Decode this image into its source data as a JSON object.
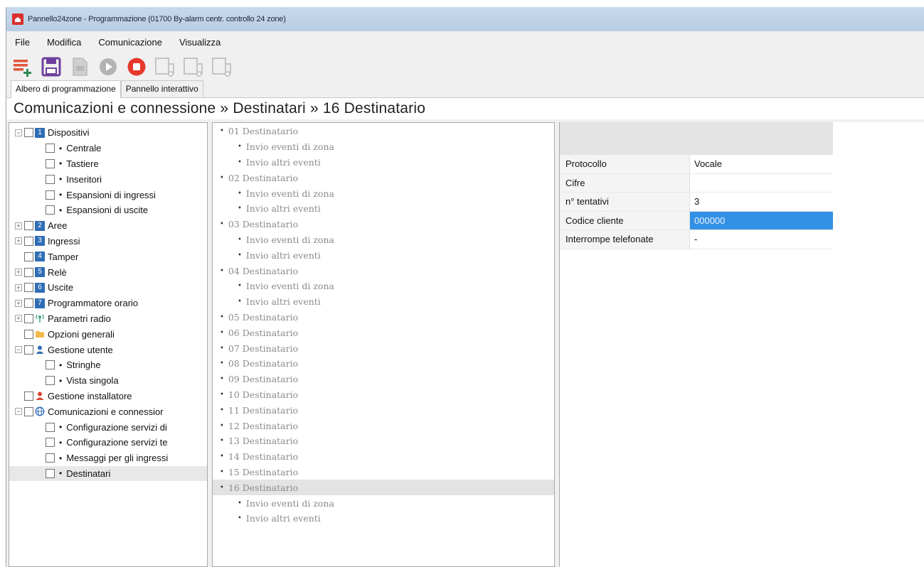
{
  "window": {
    "title": "Pannello24zone - Programmazione (01700  By-alarm centr. controllo 24 zone)"
  },
  "menu": [
    "File",
    "Modifica",
    "Comunicazione",
    "Visualizza"
  ],
  "toolbar": {
    "icons": [
      "add-list-icon",
      "save-icon",
      "document-icon",
      "play-icon",
      "stop-icon",
      "window-connect-icon",
      "window-connect-icon",
      "window-connect-icon"
    ],
    "colors": {
      "accent": "#e2543c",
      "save": "#6e3f9e",
      "stop": "#e7382c",
      "disabled": "#b9b9b9"
    }
  },
  "tabs": [
    "Albero di programmazione",
    "Pannello interattivo"
  ],
  "breadcrumb": "Comunicazioni e connessione » Destinatari » 16 Destinatario",
  "tree": [
    {
      "label": "Dispositivi",
      "level": 0,
      "expander": "-",
      "icon": "1"
    },
    {
      "label": "Centrale",
      "level": 1
    },
    {
      "label": "Tastiere",
      "level": 1
    },
    {
      "label": "Inseritori",
      "level": 1
    },
    {
      "label": "Espansioni di ingressi",
      "level": 1
    },
    {
      "label": "Espansioni di uscite",
      "level": 1
    },
    {
      "label": "Aree",
      "level": 0,
      "expander": "+",
      "icon": "2"
    },
    {
      "label": "Ingressi",
      "level": 0,
      "expander": "+",
      "icon": "3"
    },
    {
      "label": "Tamper",
      "level": 0,
      "expander": "",
      "icon": "4"
    },
    {
      "label": "Relè",
      "level": 0,
      "expander": "+",
      "icon": "5"
    },
    {
      "label": "Uscite",
      "level": 0,
      "expander": "+",
      "icon": "6"
    },
    {
      "label": "Programmatore orario",
      "level": 0,
      "expander": "+",
      "icon": "7"
    },
    {
      "label": "Parametri radio",
      "level": 0,
      "expander": "+",
      "icon": "radio"
    },
    {
      "label": "Opzioni generali",
      "level": 0,
      "expander": "",
      "icon": "folder"
    },
    {
      "label": "Gestione utente",
      "level": 0,
      "expander": "-",
      "icon": "user"
    },
    {
      "label": "Stringhe",
      "level": 1
    },
    {
      "label": "Vista singola",
      "level": 1
    },
    {
      "label": "Gestione installatore",
      "level": 0,
      "expander": "",
      "icon": "installer"
    },
    {
      "label": "Comunicazioni e connessior",
      "level": 0,
      "expander": "-",
      "icon": "globe"
    },
    {
      "label": "Configurazione servizi di",
      "level": 1
    },
    {
      "label": "Configurazione servizi te",
      "level": 1
    },
    {
      "label": "Messaggi per gli ingressi",
      "level": 1
    },
    {
      "label": "Destinatari",
      "level": 1,
      "selected": true
    }
  ],
  "destinations": [
    {
      "label": "01 Destinatario",
      "level": 0
    },
    {
      "label": "Invio eventi di zona",
      "level": 1
    },
    {
      "label": "Invio altri eventi",
      "level": 1
    },
    {
      "label": "02 Destinatario",
      "level": 0
    },
    {
      "label": "Invio eventi di zona",
      "level": 1
    },
    {
      "label": "Invio altri eventi",
      "level": 1
    },
    {
      "label": "03 Destinatario",
      "level": 0
    },
    {
      "label": "Invio eventi di zona",
      "level": 1
    },
    {
      "label": "Invio altri eventi",
      "level": 1
    },
    {
      "label": "04 Destinatario",
      "level": 0
    },
    {
      "label": "Invio eventi di zona",
      "level": 1
    },
    {
      "label": "Invio altri eventi",
      "level": 1
    },
    {
      "label": "05 Destinatario",
      "level": 0
    },
    {
      "label": "06 Destinatario",
      "level": 0
    },
    {
      "label": "07 Destinatario",
      "level": 0
    },
    {
      "label": "08 Destinatario",
      "level": 0
    },
    {
      "label": "09 Destinatario",
      "level": 0
    },
    {
      "label": "10 Destinatario",
      "level": 0
    },
    {
      "label": "11 Destinatario",
      "level": 0
    },
    {
      "label": "12 Destinatario",
      "level": 0
    },
    {
      "label": "13 Destinatario",
      "level": 0
    },
    {
      "label": "14 Destinatario",
      "level": 0
    },
    {
      "label": "15 Destinatario",
      "level": 0
    },
    {
      "label": "16 Destinatario",
      "level": 0,
      "selected": true
    },
    {
      "label": "Invio eventi di zona",
      "level": 1
    },
    {
      "label": "Invio altri eventi",
      "level": 1
    }
  ],
  "properties": [
    {
      "label": "Protocollo",
      "value": "Vocale"
    },
    {
      "label": "Cifre",
      "value": ""
    },
    {
      "label": "n° tentativi",
      "value": "3"
    },
    {
      "label": "Codice cliente",
      "value": "000000",
      "highlight": true
    },
    {
      "label": "Interrompe telefonate",
      "value": "-"
    }
  ]
}
